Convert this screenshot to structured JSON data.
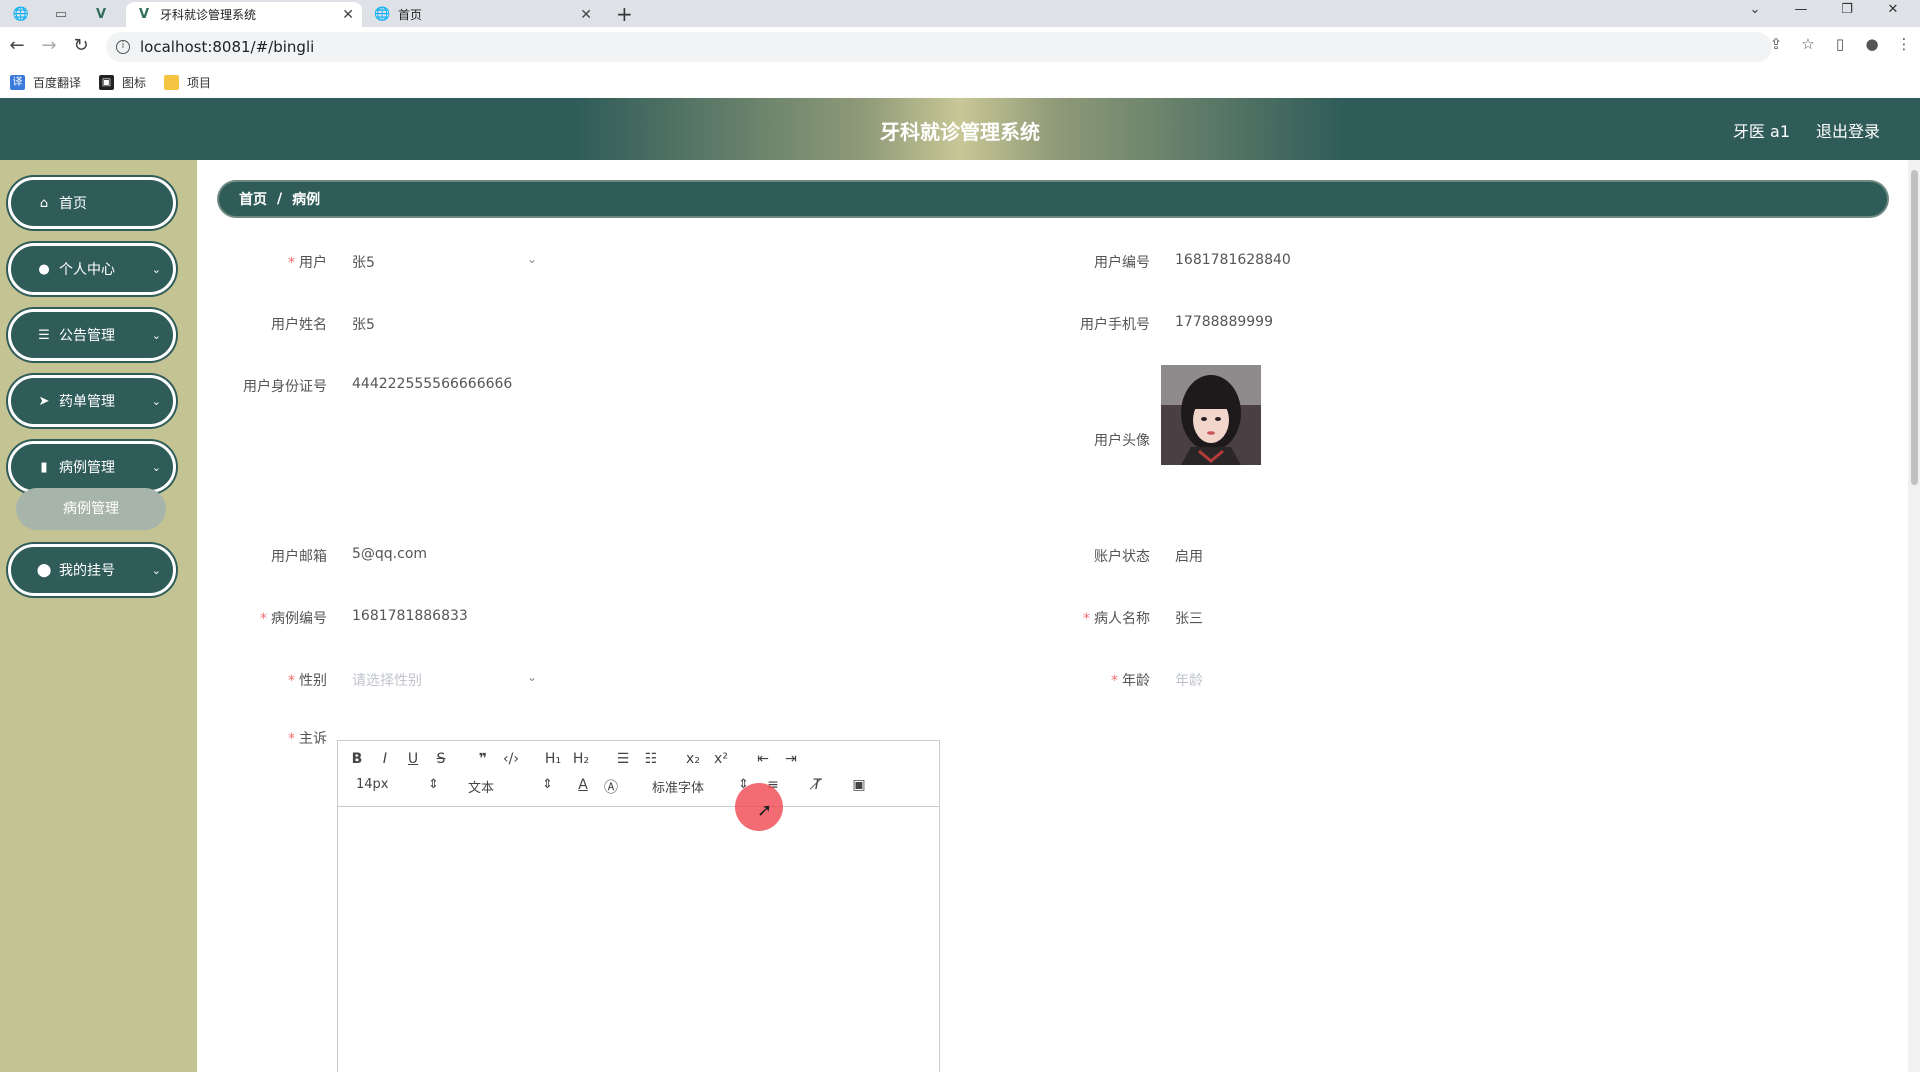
{
  "browser": {
    "tabs": [
      {
        "title": "牙科就诊管理系统"
      },
      {
        "title": "首页"
      }
    ],
    "url": "localhost:8081/#/bingli",
    "bookmarks": [
      "百度翻译",
      "图标",
      "项目"
    ]
  },
  "header": {
    "title": "牙科就诊管理系统",
    "user": "牙医 a1",
    "logout": "退出登录"
  },
  "sidebar": {
    "items": [
      {
        "label": "首页",
        "icon": "home-icon"
      },
      {
        "label": "个人中心",
        "icon": "user-icon"
      },
      {
        "label": "公告管理",
        "icon": "list-icon"
      },
      {
        "label": "药单管理",
        "icon": "send-icon"
      },
      {
        "label": "病例管理",
        "icon": "bar-chart-icon"
      },
      {
        "label": "我的挂号",
        "icon": "location-icon"
      }
    ],
    "sub_item": "病例管理"
  },
  "breadcrumb": {
    "home": "首页",
    "sep": "/",
    "current": "病例"
  },
  "form": {
    "user_label": "用户",
    "user_value": "张5",
    "user_no_label": "用户编号",
    "user_no_value": "1681781628840",
    "user_name_label": "用户姓名",
    "user_name_value": "张5",
    "user_phone_label": "用户手机号",
    "user_phone_value": "17788889999",
    "user_id_label": "用户身份证号",
    "user_id_value": "444222555566666666",
    "user_avatar_label": "用户头像",
    "user_email_label": "用户邮箱",
    "user_email_value": "5@qq.com",
    "account_status_label": "账户状态",
    "account_status_value": "启用",
    "case_no_label": "病例编号",
    "case_no_value": "1681781886833",
    "patient_name_label": "病人名称",
    "patient_name_value": "张三",
    "gender_label": "性别",
    "gender_placeholder": "请选择性别",
    "age_label": "年龄",
    "age_placeholder": "年龄",
    "complaint_label": "主诉"
  },
  "editor": {
    "font_size": "14px",
    "text_type": "文本",
    "font_family": "标准字体"
  }
}
